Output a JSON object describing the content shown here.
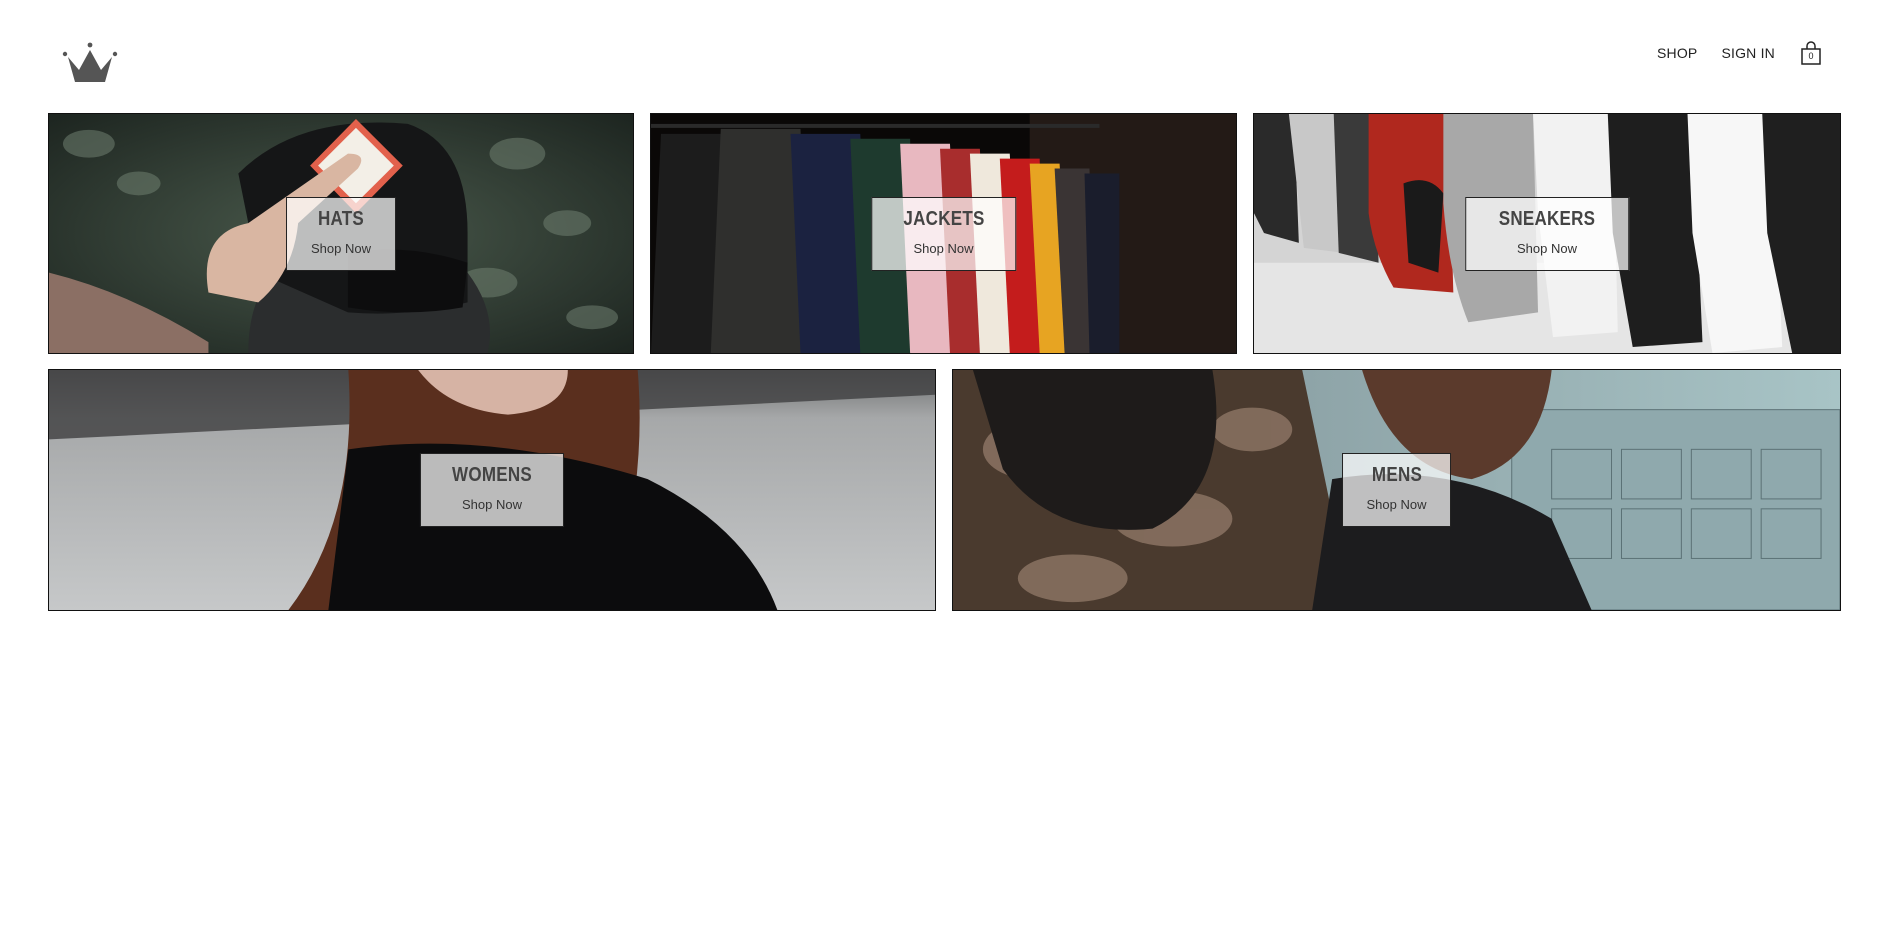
{
  "header": {
    "logo_icon": "crown-icon",
    "nav": {
      "shop": "SHOP",
      "sign_in": "SIGN IN"
    },
    "cart": {
      "icon": "shopping-bag-icon",
      "count": "0"
    }
  },
  "categories": [
    {
      "title": "HATS",
      "cta": "Shop Now"
    },
    {
      "title": "JACKETS",
      "cta": "Shop Now"
    },
    {
      "title": "SNEAKERS",
      "cta": "Shop Now"
    },
    {
      "title": "WOMENS",
      "cta": "Shop Now"
    },
    {
      "title": "MENS",
      "cta": "Shop Now"
    }
  ]
}
